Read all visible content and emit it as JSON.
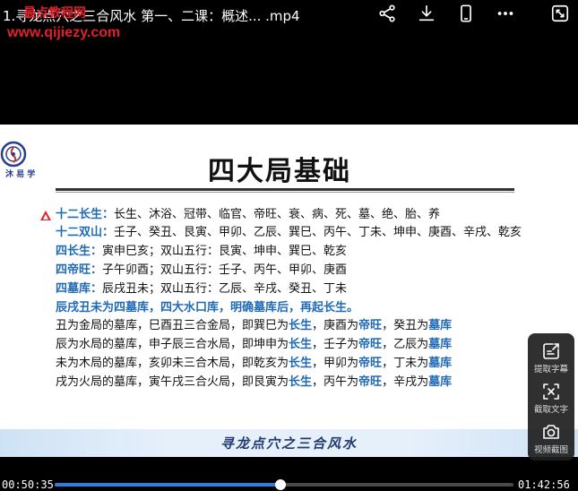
{
  "header": {
    "title": "1.寻龙点穴之三合风水 第一、二课：概述... .mp4",
    "watermark_red": "最点教程网",
    "watermark_url": "www.qijiezy.com"
  },
  "toolbar_icons": [
    "share-icon",
    "download-icon",
    "phone-icon",
    "more-icon",
    "exit-fullscreen-icon"
  ],
  "slide": {
    "logo_text": "沐 易 学",
    "title": "四大局基础",
    "footer": "寻龙点穴之三合风水",
    "lines": [
      {
        "label": "十二长生：",
        "text": "长生、沐浴、冠带、临官、帝旺、衰、病、死、墓、绝、胎、养"
      },
      {
        "label": "十二双山：",
        "text": "壬子、癸丑、艮寅、甲卯、乙辰、巽巳、丙午、丁未、坤申、庚酉、辛戌、乾亥"
      },
      {
        "label": "四长生：",
        "text": "寅申巳亥；双山五行：艮寅、坤申、巽巳、乾亥"
      },
      {
        "label": "四帝旺：",
        "text": "子午卯酉；双山五行：壬子、丙午、甲卯、庚酉"
      },
      {
        "label": "四墓库：",
        "text": "辰戌丑未；双山五行：乙辰、辛戌、癸丑、丁未"
      },
      {
        "label": "辰戌丑未为四墓库，四大水口库，明确墓库后，再起长生。",
        "text": ""
      },
      {
        "a": "丑为金局的墓库，巳酉丑三合金局，即巽巳为",
        "b1": "长生",
        "c": "，庚酉为",
        "b2": "帝旺",
        "d": "，癸丑为",
        "b3": "墓库"
      },
      {
        "a": "辰为水局的墓库，申子辰三合水局，即坤申为",
        "b1": "长生",
        "c": "，壬子为",
        "b2": "帝旺",
        "d": "，乙辰为",
        "b3": "墓库"
      },
      {
        "a": "未为木局的墓库，亥卯未三合木局，即乾亥为",
        "b1": "长生",
        "c": "，甲卯为",
        "b2": "帝旺",
        "d": "，丁未为",
        "b3": "墓库"
      },
      {
        "a": "戌为火局的墓库，寅午戌三合火局，即艮寅为",
        "b1": "长生",
        "c": "，丙午为",
        "b2": "帝旺",
        "d": "，辛戌为",
        "b3": "墓库"
      }
    ]
  },
  "side_tools": [
    {
      "label": "提取字幕",
      "icon": "extract-subtitle-icon"
    },
    {
      "label": "截取文字",
      "icon": "capture-text-icon"
    },
    {
      "label": "视频截图",
      "icon": "camera-icon"
    }
  ],
  "player": {
    "current_time": "00:50:35",
    "total_time": "01:42:56",
    "progress": 0.4914,
    "accent_color": "#2a7de1"
  }
}
